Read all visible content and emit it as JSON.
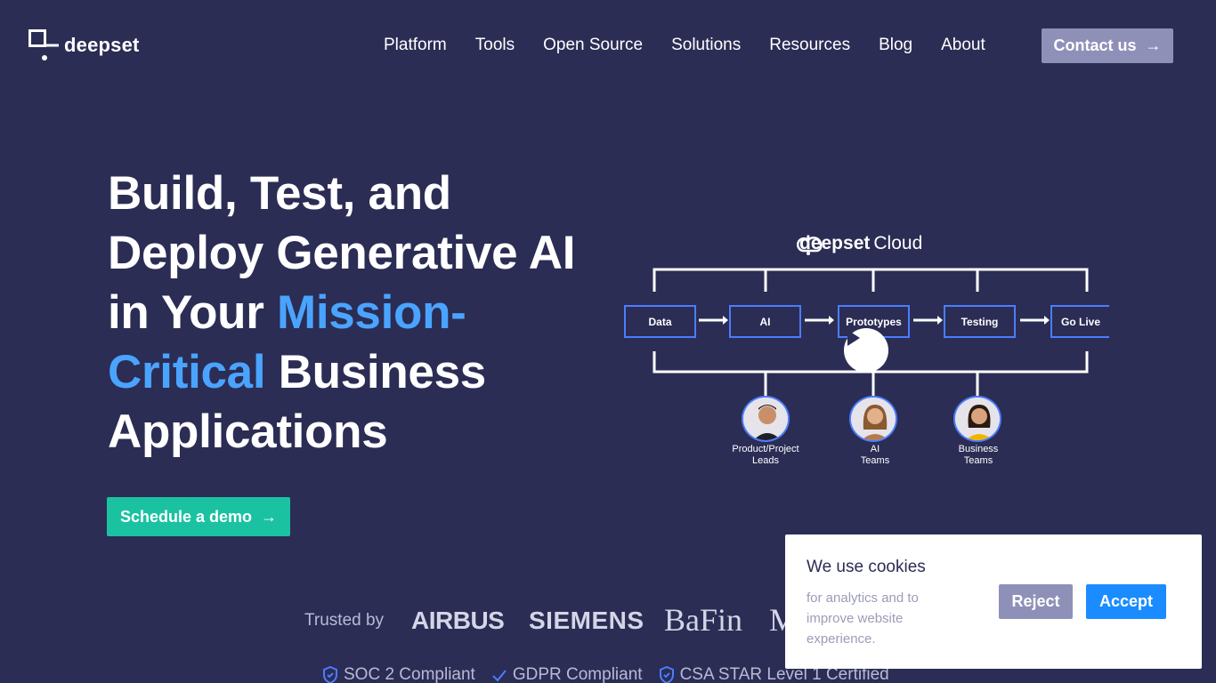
{
  "brand": {
    "name": "deepset"
  },
  "nav": {
    "items": [
      {
        "label": "Platform"
      },
      {
        "label": "Tools"
      },
      {
        "label": "Open Source"
      },
      {
        "label": "Solutions"
      },
      {
        "label": "Resources"
      },
      {
        "label": "Blog"
      },
      {
        "label": "About"
      }
    ],
    "contact_label": "Contact us"
  },
  "hero": {
    "line1": "Build, Test, and",
    "line2": "Deploy Generative AI",
    "line3_plain": "in Your ",
    "line3_accent": "Mission-",
    "line4_accent": "Critical",
    "line4_plain": " Business",
    "line5": "Applications",
    "cta_label": "Schedule a demo"
  },
  "diagram": {
    "logo_bold": "deepset",
    "logo_light": "Cloud",
    "stages": [
      "Data",
      "AI",
      "Prototypes",
      "Testing",
      "Go Live"
    ],
    "roles": [
      {
        "line1": "Product/Project",
        "line2": "Leads"
      },
      {
        "line1": "AI",
        "line2": "Teams"
      },
      {
        "line1": "Business",
        "line2": "Teams"
      }
    ]
  },
  "trust": {
    "label": "Trusted by",
    "brands": [
      "AIRBUS",
      "SIEMENS",
      "BaFin",
      "M"
    ],
    "certs": [
      "SOC 2 Compliant",
      "GDPR Compliant",
      "CSA STAR Level 1 Certified"
    ]
  },
  "cookie": {
    "title": "We use cookies",
    "text": "for analytics and to improve website experience.",
    "reject": "Reject",
    "accept": "Accept"
  },
  "colors": {
    "background": "#2b2d55",
    "accent": "#4aa4ff",
    "cta": "#1bc2a1",
    "accept": "#1a8cff",
    "muted_button": "#8f90b8",
    "diagram_blue": "#4a7dff"
  }
}
